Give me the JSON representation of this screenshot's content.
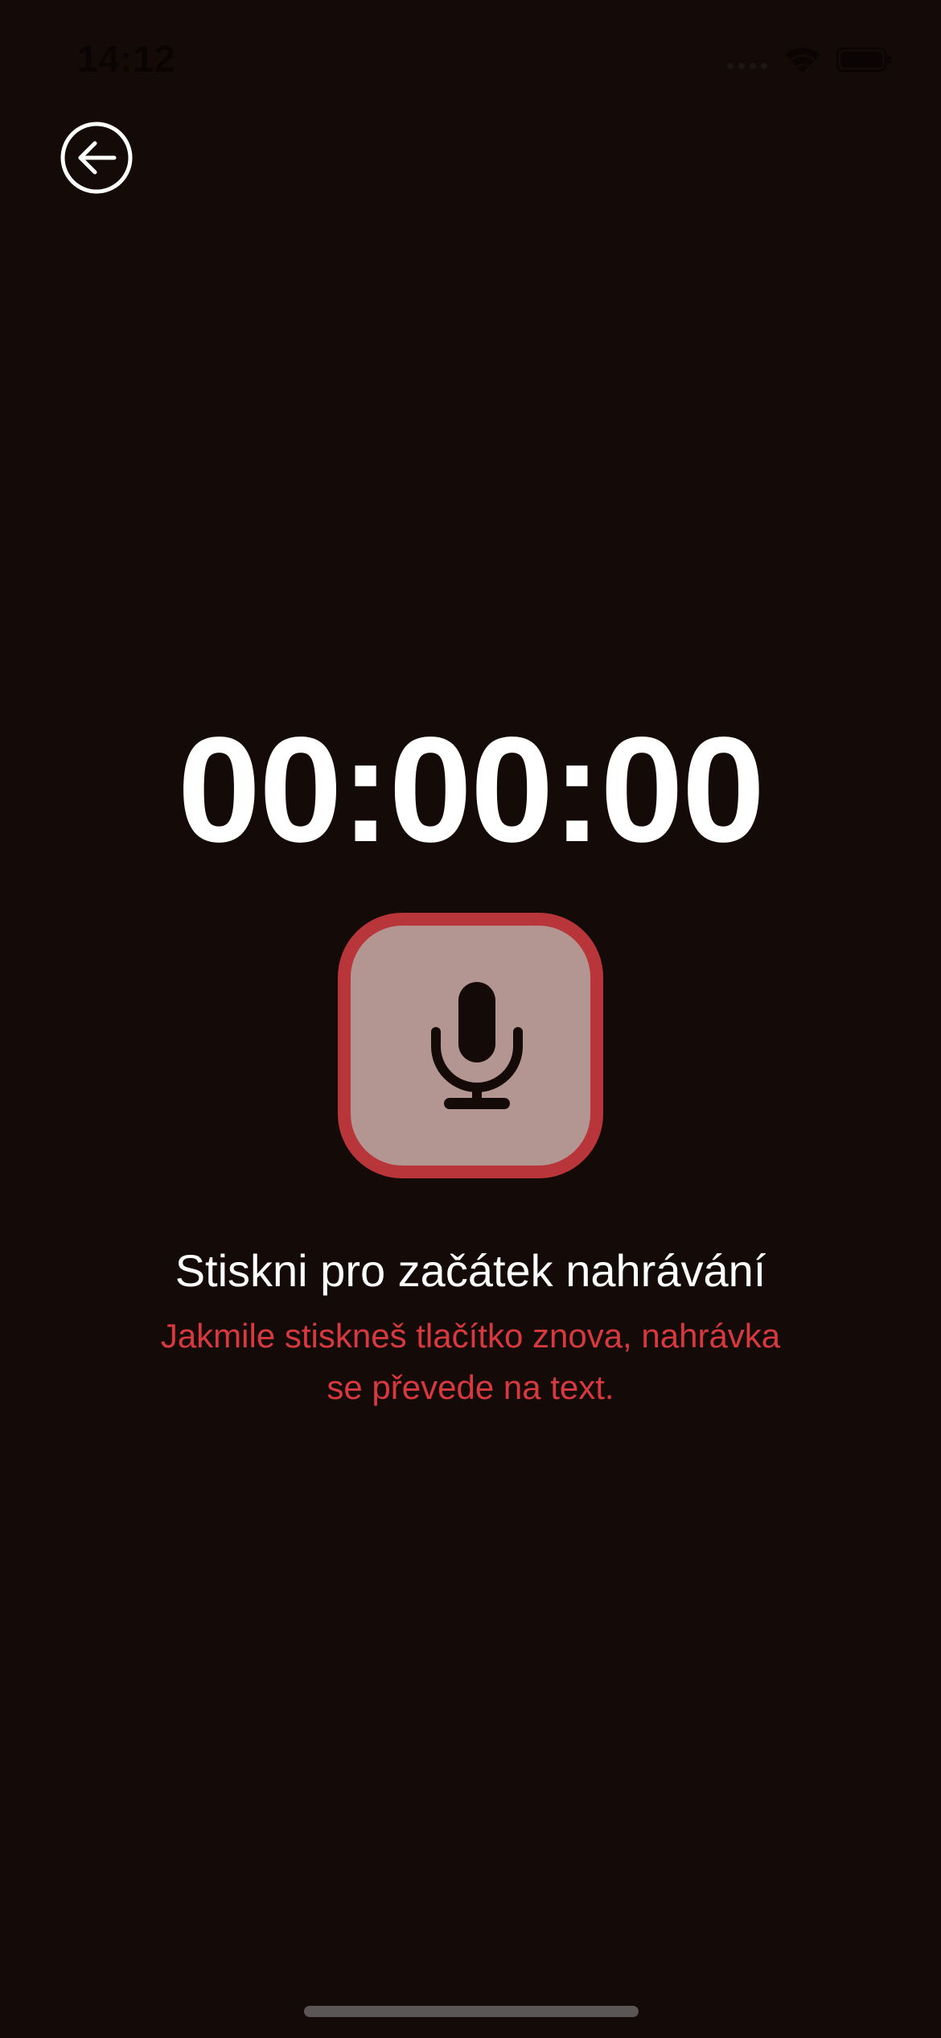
{
  "status_bar": {
    "time": "14:12"
  },
  "icons": {
    "back": "arrow-left-circle-icon",
    "record": "microphone-icon",
    "wifi": "wifi-icon",
    "battery": "battery-icon",
    "signal": "cellular-signal-icon"
  },
  "recorder": {
    "timer": "00:00:00",
    "instruction": "Stiskni pro začátek nahrávání",
    "hint": "Jakmile stiskneš tlačítko znova, nahrávka se převede na text."
  },
  "colors": {
    "background": "#140b08",
    "accent_red": "#b8353a",
    "hint_red": "#d8393e",
    "button_fill": "#b39592",
    "text": "#ffffff"
  }
}
